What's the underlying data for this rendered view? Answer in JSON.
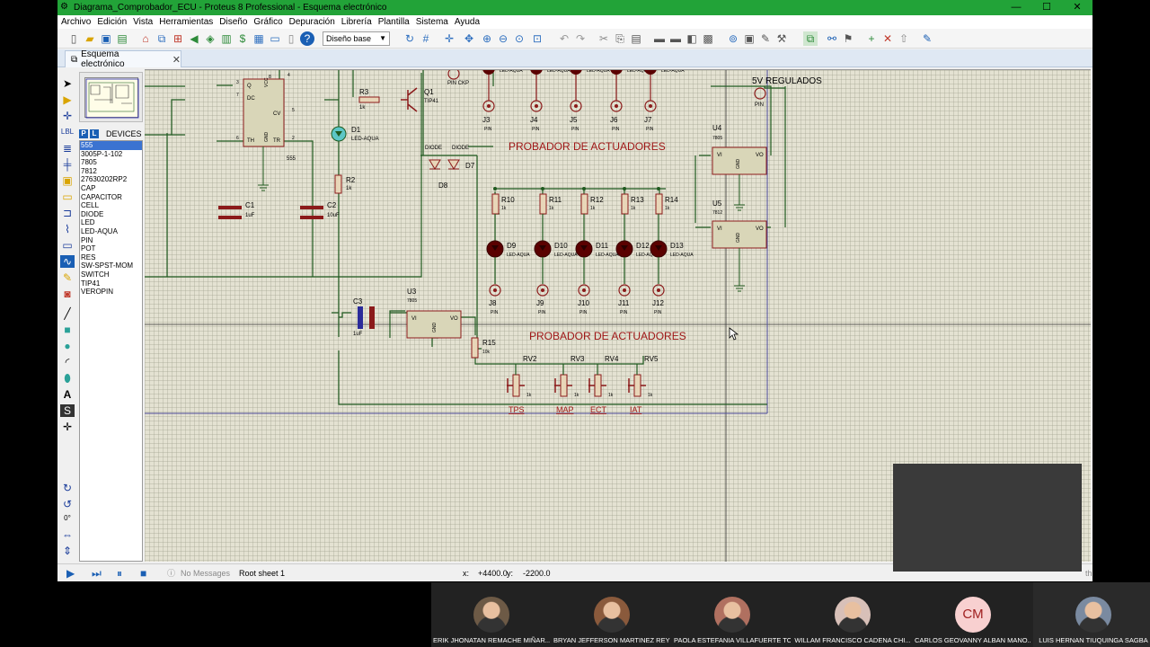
{
  "window": {
    "title": "Diagrama_Comprobador_ECU - Proteus 8 Professional - Esquema electrónico",
    "minimize": "—",
    "maximize": "☐",
    "close": "✕"
  },
  "menu": [
    "Archivo",
    "Edición",
    "Vista",
    "Herramientas",
    "Diseño",
    "Gráfico",
    "Depuración",
    "Librería",
    "Plantilla",
    "Sistema",
    "Ayuda"
  ],
  "toolbar": {
    "layer_combo": "Diseño base"
  },
  "tab": {
    "label": "Esquema electrónico",
    "close": "✕"
  },
  "device_panel": {
    "p_button": "P",
    "l_button": "L",
    "title": "DEVICES",
    "selected_index": 0,
    "items": [
      "555",
      "3005P-1-102",
      "7805",
      "7812",
      "27630202RP2",
      "CAP",
      "CAPACITOR",
      "CELL",
      "DIODE",
      "LED",
      "LED-AQUA",
      "PIN",
      "POT",
      "RES",
      "SW-SPST-MOM",
      "SWITCH",
      "TIP41",
      "VEROPIN"
    ]
  },
  "rotation_label": "0°",
  "schematic": {
    "heading_top": "PROBADOR DE ACTUADORES",
    "heading_bottom": "PROBADOR DE ACTUADORES",
    "regulated_label": "5V REGULADOS",
    "pin_ckp": "PIN CKP",
    "chip_555": {
      "q": "Q",
      "dc": "DC",
      "th": "TH",
      "cv": "CV",
      "tr": "TR",
      "vcc": "VCC",
      "gnd": "GND",
      "name": "555",
      "pin2": "2",
      "pin3": "3",
      "pin4": "4",
      "pin5": "5",
      "pin6": "6",
      "pin7": "7",
      "pin8": "8"
    },
    "components": {
      "c1": "C1",
      "c1_val": "1uF",
      "c2": "C2",
      "c2_val": "10uF",
      "c3": "C3",
      "c3_val": "1uF",
      "r2": "R2",
      "r2_val": "1k",
      "r3": "R3",
      "r3_val": "1k",
      "d1": "D1",
      "d1_val": "LED-AQUA",
      "q1": "Q1",
      "q1_val": "TIP41",
      "d7": "D7",
      "d8": "D8",
      "diode": "DIODE",
      "u3": "U3",
      "u3_val": "7805",
      "u4": "U4",
      "u4_val": "7805",
      "u5": "U5",
      "u5_val": "7812",
      "vi": "VI",
      "vo": "VO",
      "gnd": "GND",
      "r15": "R15",
      "r15_val": "10k",
      "pin": "PIN",
      "led_aqua": "LED-AQUA",
      "one_k": "1k"
    },
    "top_jacks": [
      "J3",
      "J4",
      "J5",
      "J6",
      "J7"
    ],
    "resistors": [
      "R10",
      "R11",
      "R12",
      "R13",
      "R14"
    ],
    "leds": [
      "D9",
      "D10",
      "D11",
      "D12",
      "D13"
    ],
    "bottom_jacks": [
      "J8",
      "J9",
      "J10",
      "J11",
      "J12"
    ],
    "pots": [
      "RV2",
      "RV3",
      "RV4",
      "RV5"
    ],
    "sensors": [
      "TPS",
      "MAP",
      "ECT",
      "IAT"
    ],
    "u5_label": "5V REGULADOS"
  },
  "status": {
    "messages": "No Messages",
    "sheet": "Root sheet 1",
    "x_label": "x:",
    "x_value": "+4400.0",
    "y_label": "y:",
    "y_value": "-2200.0",
    "trailing": "th"
  },
  "participants": [
    {
      "name": "ERIK JHONATAN REMACHE MIÑAR...",
      "initials": ""
    },
    {
      "name": "BRYAN JEFFERSON MARTINEZ REYES",
      "initials": ""
    },
    {
      "name": "PAOLA ESTEFANIA VILLAFUERTE TO...",
      "initials": ""
    },
    {
      "name": "WILLAM FRANCISCO CADENA CHI...",
      "initials": ""
    },
    {
      "name": "CARLOS GEOVANNY ALBAN MANO...",
      "initials": "CM"
    },
    {
      "name": "LUIS HERNAN TIUQUINGA SAGBA",
      "initials": ""
    }
  ],
  "colors": {
    "titlebar": "#22a338",
    "wire": "#1f5a1f",
    "component": "#8b1a1a",
    "led_fill": "#5a0000",
    "heading": "#a01818",
    "canvas": "#e4e2d2"
  }
}
